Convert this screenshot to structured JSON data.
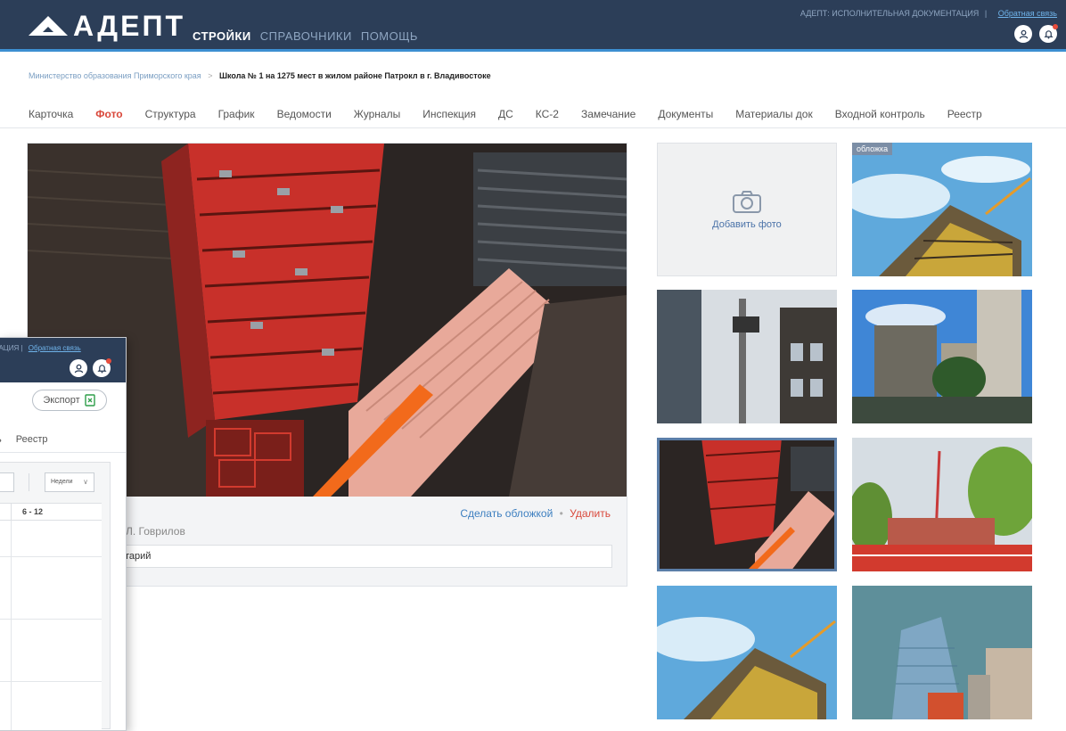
{
  "header": {
    "logo_text": "АДЕПТ",
    "nav": [
      "СТРОЙКИ",
      "СПРАВОЧНИКИ",
      "ПОМОЩЬ"
    ],
    "active_nav": "СТРОЙКИ",
    "app_subtitle": "АДЕПТ: ИСПОЛНИТЕЛЬНАЯ ДОКУМЕНТАЦИЯ",
    "feedback_link": "Обратная связь",
    "user_icon": "user-icon",
    "notification_icon": "bell-icon"
  },
  "breadcrumb": {
    "parent": "Министерство образования Приморского края",
    "separator": ">",
    "current": "Школа № 1 на 1275 мест в жилом районе Патрокл в г. Владивостоке"
  },
  "tabs": [
    "Карточка",
    "Фото",
    "Структура",
    "График",
    "Ведомости",
    "Журналы",
    "Инспекция",
    "ДС",
    "КС-2",
    "Замечание",
    "Документы",
    "Материалы док",
    "Входной контроль",
    "Реестр"
  ],
  "active_tab": "Фото",
  "photo": {
    "actions": {
      "make_cover": "Сделать обложкой",
      "separator": "•",
      "delete": "Удалить"
    },
    "author": "Л. Говрилов",
    "comment": "тарий"
  },
  "gallery": {
    "add_photo_label": "Добавить фото",
    "cover_badge": "обложка"
  },
  "overlay_window": {
    "header_text": "ОКУМЕНТАЦИЯ",
    "feedback_link": "Обратная связь",
    "export_label": "Экспорт",
    "tabs": [
      "ь",
      "Реестр"
    ],
    "period_select": "Недели",
    "column_header": "6 - 12"
  },
  "colors": {
    "header_bg": "#2c3e58",
    "accent_blue": "#3d8fd1",
    "active_red": "#d9483b",
    "link_blue": "#3d7fc0"
  }
}
